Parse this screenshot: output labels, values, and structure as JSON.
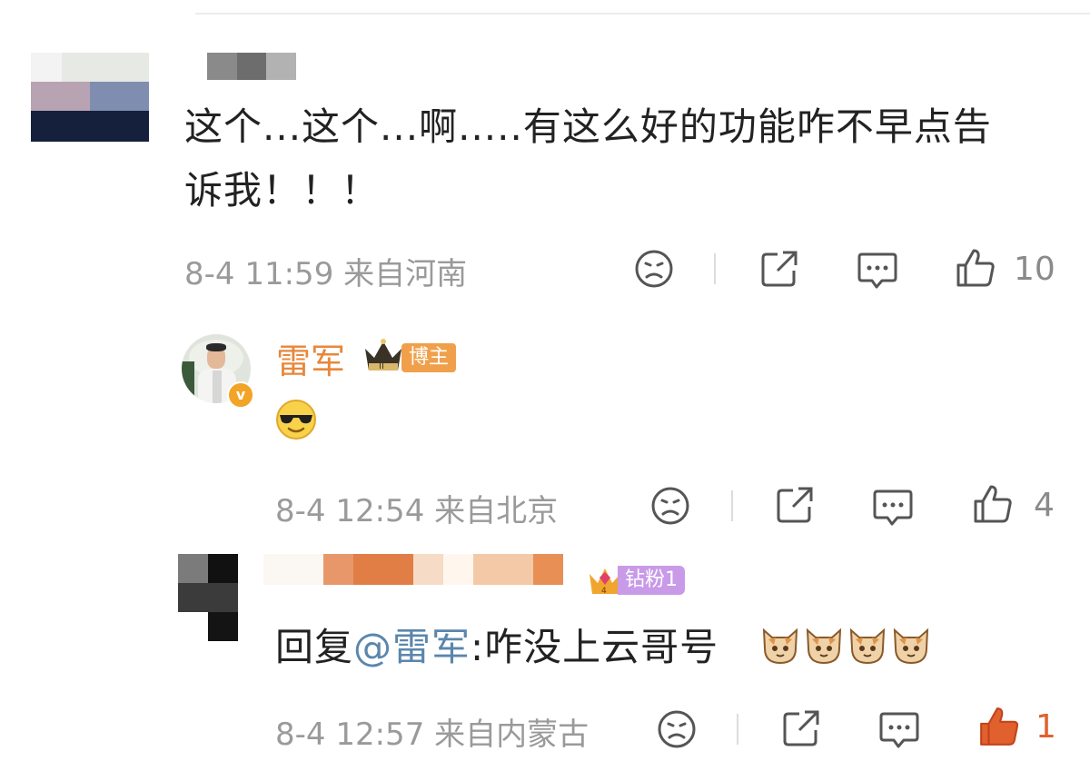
{
  "comments": [
    {
      "text": "这个...这个...啊.....有这么好的功能咋不早点告诉我！！！",
      "text_line1": "这个...这个...啊.....有这么好的功能咋不早点告",
      "text_line2": "诉我！！！",
      "meta": "8-4 11:59 来自河南",
      "likes": "10"
    },
    {
      "name": "雷军",
      "badge": "博主",
      "emoji": "sunglasses-emoji",
      "meta": "8-4 12:54 来自北京",
      "likes": "4"
    },
    {
      "badge": "钻粉1",
      "reply_prefix": "回复",
      "mention": "@雷军",
      "reply_text": ":咋没上云哥号",
      "emojis": [
        "cat-emoji",
        "cat-emoji",
        "cat-emoji",
        "cat-emoji"
      ],
      "meta": "8-4 12:57 来自内蒙古",
      "likes": "1"
    }
  ],
  "colors": {
    "name": "#e8873a",
    "mention": "#5b86ad",
    "meta": "#9a9a9a",
    "badge_blogger": "#f0a04b",
    "badge_fan": "#c89ae8"
  }
}
